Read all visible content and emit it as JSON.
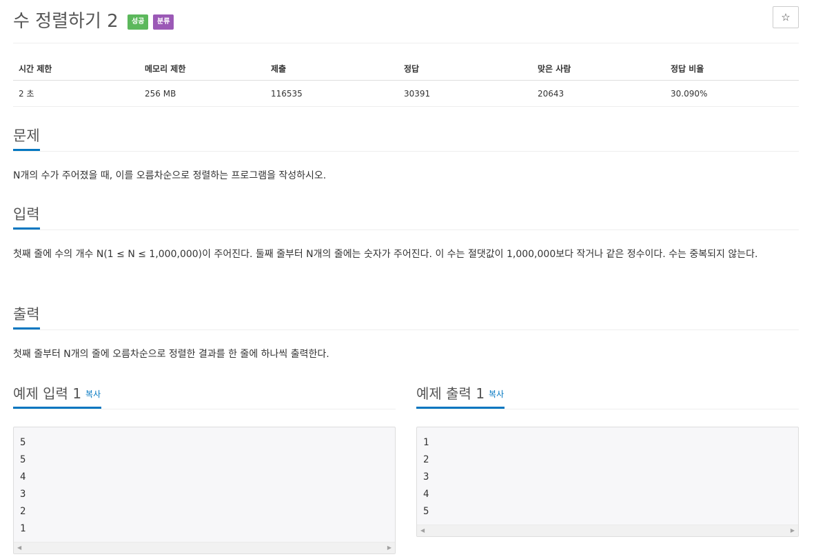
{
  "problem": {
    "title": "수 정렬하기 2",
    "badges": {
      "success": "성공",
      "category": "분류"
    },
    "star_icon": "☆"
  },
  "info_table": {
    "headers": [
      "시간 제한",
      "메모리 제한",
      "제출",
      "정답",
      "맞은 사람",
      "정답 비율"
    ],
    "values": [
      "2 초",
      "256 MB",
      "116535",
      "30391",
      "20643",
      "30.090%"
    ]
  },
  "sections": {
    "problem": {
      "heading": "문제",
      "body": "N개의 수가 주어졌을 때, 이를 오름차순으로 정렬하는 프로그램을 작성하시오."
    },
    "input": {
      "heading": "입력",
      "body": "첫째 줄에 수의 개수 N(1 ≤ N ≤ 1,000,000)이 주어진다. 둘째 줄부터 N개의 줄에는 숫자가 주어진다. 이 수는 절댓값이 1,000,000보다 작거나 같은 정수이다. 수는 중복되지 않는다."
    },
    "output": {
      "heading": "출력",
      "body": "첫째 줄부터 N개의 줄에 오름차순으로 정렬한 결과를 한 줄에 하나씩 출력한다."
    }
  },
  "samples": {
    "input": {
      "heading": "예제 입력 1",
      "copy_label": "복사",
      "content": "5\n5\n4\n3\n2\n1"
    },
    "output": {
      "heading": "예제 출력 1",
      "copy_label": "복사",
      "content": "1\n2\n3\n4\n5"
    }
  },
  "colors": {
    "accent": "#0076c0",
    "badge_success": "#5cb85c",
    "badge_category": "#9b59b6"
  }
}
